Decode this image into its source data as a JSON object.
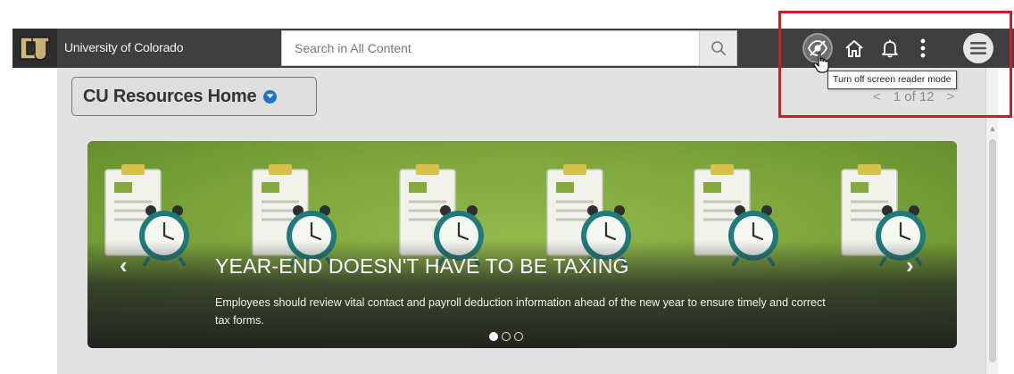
{
  "header": {
    "org_name": "University of Colorado",
    "search": {
      "placeholder": "Search in All Content"
    },
    "icons": [
      "cu-logo-icon",
      "search-icon",
      "accessibility-icon",
      "home-icon",
      "bell-icon",
      "more-vertical-icon",
      "hamburger-menu-icon"
    ],
    "tooltip": "Turn off screen reader mode"
  },
  "homepage": {
    "title": "CU Resources Home",
    "pager": {
      "prev": "<",
      "text": "1 of 12",
      "next": ">"
    }
  },
  "banner": {
    "headline": "YEAR-END DOESN'T HAVE TO BE TAXING",
    "body": "Employees should review vital contact and payroll deduction information ahead of the new year to ensure timely and correct tax forms.",
    "slides": 3,
    "active_slide": 1,
    "prev_arrow": "‹",
    "next_arrow": "›"
  },
  "colors": {
    "header_bg": "#3f3f3f",
    "highlight_box": "#c8202a",
    "banner_green": "#7aa33a",
    "dropdown_caret": "#1e74c9",
    "clock_teal": "#1f7b7b"
  }
}
